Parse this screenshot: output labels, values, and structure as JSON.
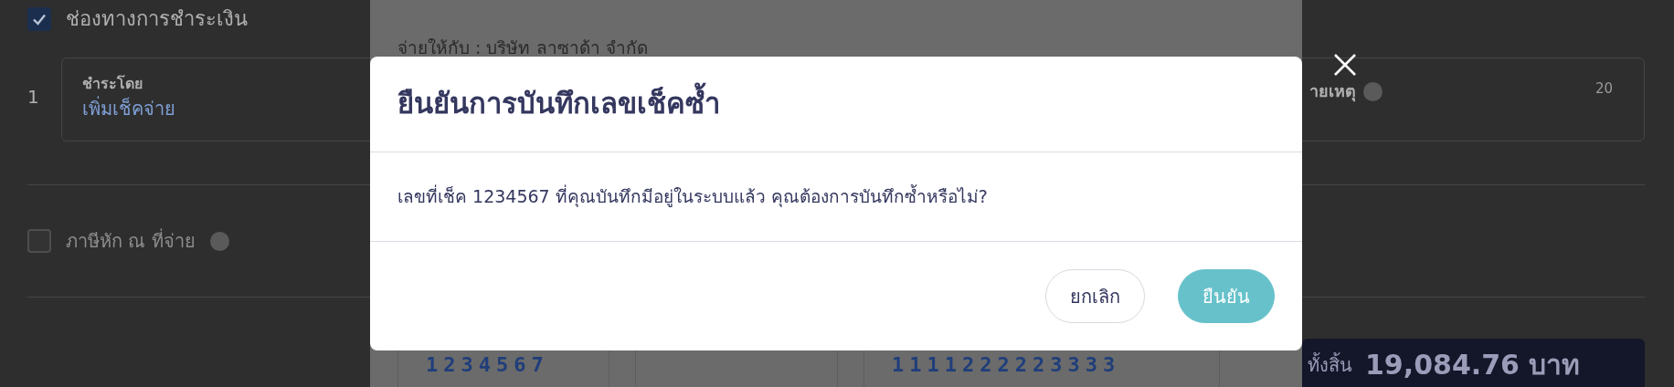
{
  "payment_section": {
    "label": "ช่องทางการชำระเงิน",
    "checked": true
  },
  "payment_rows": [
    {
      "number": "1",
      "field_label": "ชำระโดย",
      "link": "เพิ่มเช็คจ่าย",
      "note_label": "ายเหตุ",
      "note_count": "20"
    }
  ],
  "withholding_tax": {
    "label": "ภาษีหัก ณ ที่จ่าย",
    "checked": false,
    "disabled": true
  },
  "total": {
    "label": "ทั้งสิ้น",
    "amount": "19,084.76 บาท"
  },
  "check_preview": {
    "payee": "จ่ายให้กับ : บริษัท ลาซาด้า จำกัด",
    "micr_fields": [
      "1234567",
      "1111222223333"
    ]
  },
  "dialog": {
    "title": "ยืนยันการบันทึกเลขเช็คซ้ำ",
    "message": "เลขที่เช็ค 1234567 ที่คุณบันทึกมีอยู่ในระบบแล้ว คุณต้องการบันทึกซ้ำหรือไม่?",
    "buttons": [
      {
        "label": "ยกเลิก",
        "kind": "secondary"
      },
      {
        "label": "ยืนยัน",
        "kind": "primary"
      }
    ]
  }
}
